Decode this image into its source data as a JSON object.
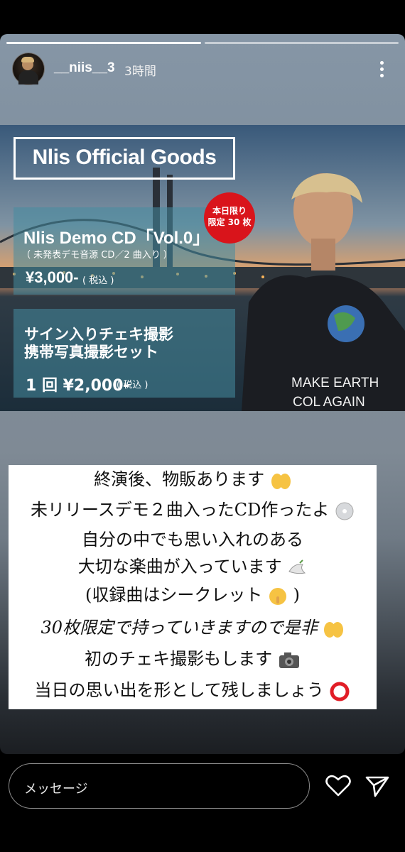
{
  "story": {
    "username": "__niis__3",
    "time": "3時間",
    "progress_segments": 2
  },
  "banner": {
    "title": "Nlis Official Goods",
    "badge_line1": "本日限り",
    "badge_line2": "限定 30 枚",
    "cd_title": "Nlis Demo CD「Vol.0」",
    "cd_subtitle": "（ 未発表デモ音源 CD／2 曲入り ）",
    "cd_price": "¥3,000-",
    "cd_tax": "( 税込 )",
    "cheki_line1": "サイン入りチェキ撮影",
    "cheki_line2": "携帯写真撮影セット",
    "cheki_price": "1 回 ¥2,000-",
    "cheki_tax": "( 税込 )",
    "shirt_line1": "MAKE EARTH",
    "shirt_line2": "COL AGAIN"
  },
  "caption": {
    "lines": [
      "終演後、物販あります",
      "未リリースデモ２曲入ったCD作ったよ",
      "自分の中でも思い入れのある",
      "大切な楽曲が入っています",
      "(収録曲はシークレット",
      ")",
      "30枚限定で持っていきますので是非",
      "初のチェキ撮影もします",
      "当日の思い出を形として残しましょう"
    ]
  },
  "reply": {
    "placeholder": "メッセージ"
  },
  "icons": [
    "more-icon",
    "heart-icon",
    "send-icon",
    "hands-emoji",
    "disc-emoji",
    "dove-emoji",
    "shush-emoji",
    "camera-emoji",
    "circle-emoji"
  ]
}
